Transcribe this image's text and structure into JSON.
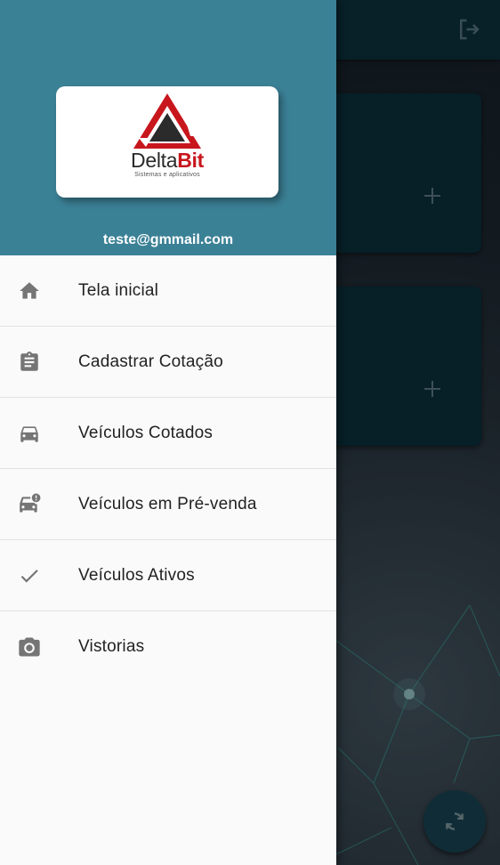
{
  "drawer": {
    "logo": {
      "brand_part1": "Delta",
      "brand_part2": "Bit",
      "tagline": "Sistemas e aplicativos"
    },
    "email": "teste@gmmail.com",
    "items": [
      {
        "label": "Tela inicial",
        "icon": "home-icon"
      },
      {
        "label": "Cadastrar Cotação",
        "icon": "clipboard-icon"
      },
      {
        "label": "Veículos Cotados",
        "icon": "car-front-icon"
      },
      {
        "label": "Veículos em Pré-venda",
        "icon": "car-alert-icon"
      },
      {
        "label": "Veículos Ativos",
        "icon": "check-icon"
      },
      {
        "label": "Vistorias",
        "icon": "camera-icon"
      }
    ]
  },
  "background": {
    "appbar_icons": [
      "menu-icon",
      "logout-icon"
    ],
    "cards": [
      {
        "icon": "plus-icon"
      },
      {
        "icon": "plus-icon"
      }
    ],
    "fab_icon": "refresh-icon"
  },
  "colors": {
    "drawer_header": "#3b8196",
    "appbar": "#0d3441",
    "brand_red": "#c8161d",
    "icon_gray": "#757575"
  }
}
